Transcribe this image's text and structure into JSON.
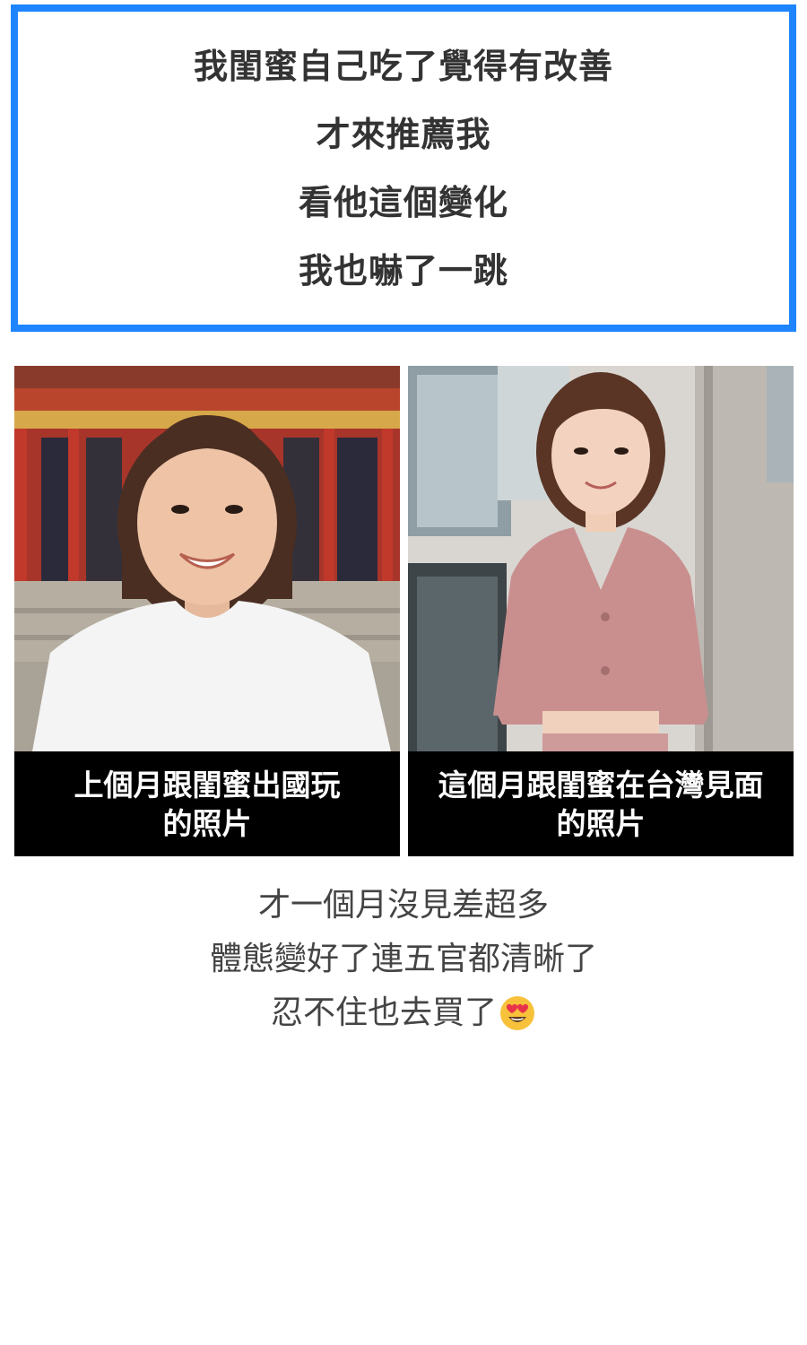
{
  "headline": {
    "lines": [
      "我閨蜜自己吃了覺得有改善",
      "才來推薦我",
      "看他這個變化",
      "我也嚇了一跳"
    ],
    "border_color": "#1f85ff"
  },
  "photos": {
    "before": {
      "caption_lines": [
        "上個月跟閨蜜出國玩",
        "的照片"
      ],
      "image_desc": "woman-white-tshirt-temple"
    },
    "after": {
      "caption_lines": [
        "這個月跟閨蜜在台灣見面",
        "的照片"
      ],
      "image_desc": "woman-pink-jacket-building"
    }
  },
  "body": {
    "lines": [
      "才一個月沒見差超多",
      "體態變好了連五官都清晰了",
      "忍不住也去買了"
    ],
    "trailing_emoji": "heart-eyes-emoji"
  }
}
